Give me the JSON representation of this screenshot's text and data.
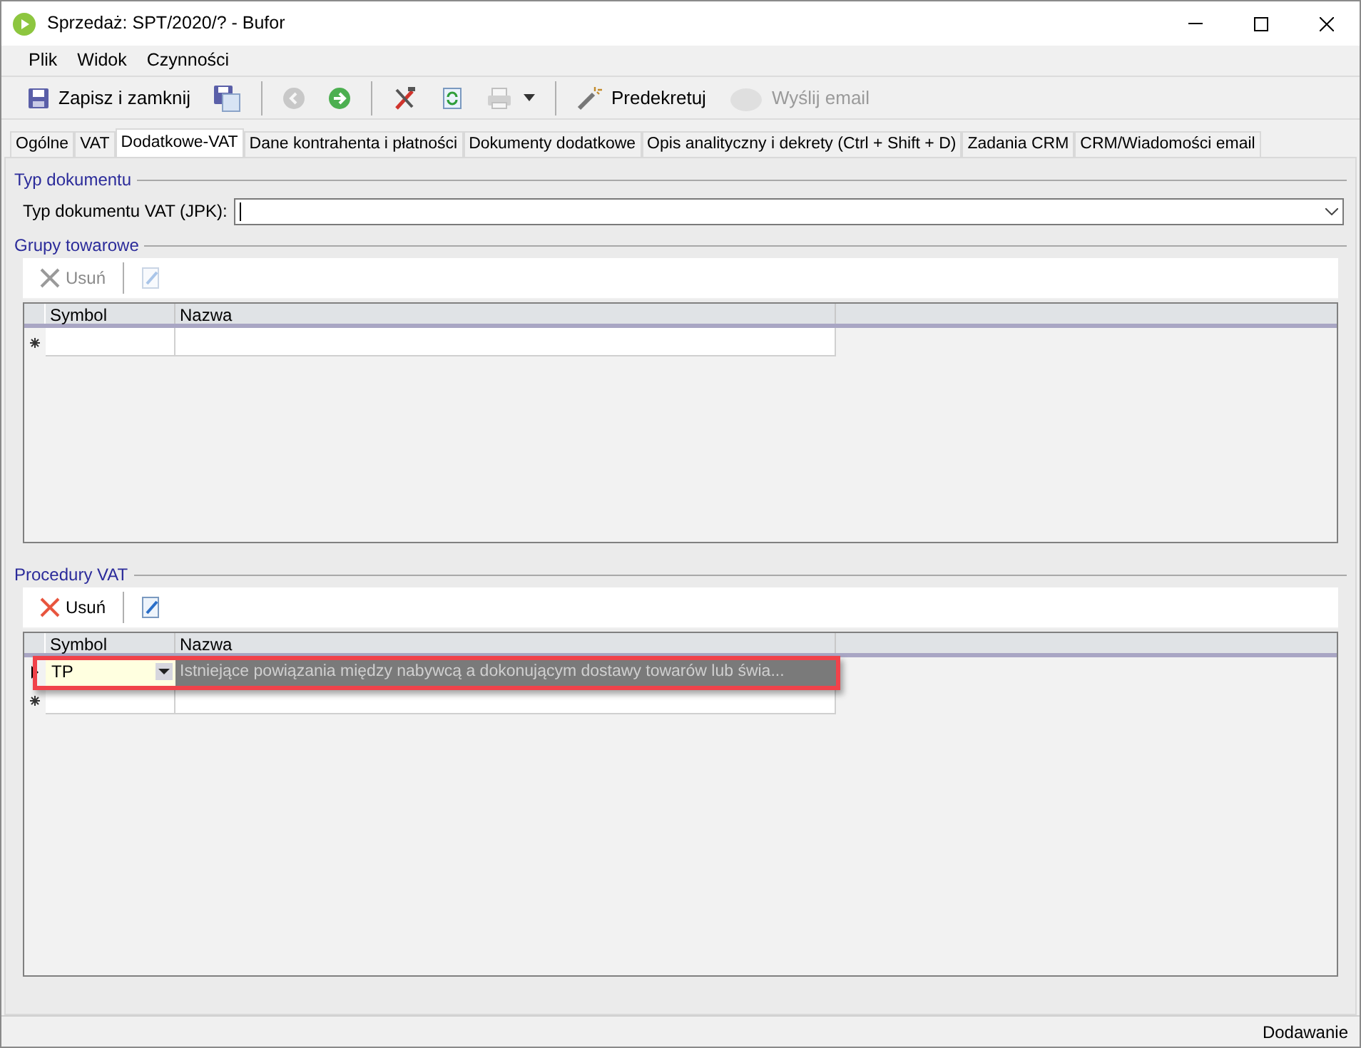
{
  "window": {
    "title": "Sprzedaż: SPT/2020/? - Bufor"
  },
  "menu": [
    "Plik",
    "Widok",
    "Czynności"
  ],
  "toolbar": [
    {
      "kind": "save",
      "label": "Zapisz i zamknij",
      "disabled": false
    },
    {
      "kind": "save-as",
      "disabled": false
    },
    {
      "kind": "back",
      "disabled": true
    },
    {
      "kind": "forward",
      "disabled": false
    },
    {
      "kind": "tools",
      "disabled": false
    },
    {
      "kind": "refresh",
      "disabled": false
    },
    {
      "kind": "print",
      "disabled": true
    },
    {
      "kind": "predecree",
      "label": "Predekretuj",
      "disabled": false
    },
    {
      "kind": "email",
      "label": "Wyślij email",
      "disabled": true
    }
  ],
  "tabs": [
    {
      "label": "Ogólne",
      "selected": false
    },
    {
      "label": "VAT",
      "selected": false
    },
    {
      "label": "Dodatkowe-VAT",
      "selected": true
    },
    {
      "label": "Dane kontrahenta i płatności",
      "selected": false
    },
    {
      "label": "Dokumenty dodatkowe",
      "selected": false
    },
    {
      "label": "Opis analityczny i dekrety (Ctrl + Shift + D)",
      "selected": false
    },
    {
      "label": "Zadania CRM",
      "selected": false
    },
    {
      "label": "CRM/Wiadomości email",
      "selected": false
    }
  ],
  "document_type": {
    "heading": "Typ dokumentu",
    "label": "Typ dokumentu VAT (JPK):"
  },
  "groups": {
    "heading": "Grupy towarowe",
    "delete": {
      "label": "Usuń",
      "disabled": true
    },
    "edit_disabled": true,
    "columns": [
      "Symbol",
      "Nazwa"
    ]
  },
  "procedures": {
    "heading": "Procedury VAT",
    "delete": {
      "label": "Usuń",
      "disabled": false
    },
    "edit_disabled": false,
    "columns": [
      "Symbol",
      "Nazwa"
    ],
    "rows": [
      {
        "symbol": "TP",
        "name": "Istniejące powiązania między nabywcą a dokonującym dostawy towarów lub świa...",
        "selected": true,
        "highlighted": true
      }
    ]
  },
  "status_bar": "Dodawanie"
}
